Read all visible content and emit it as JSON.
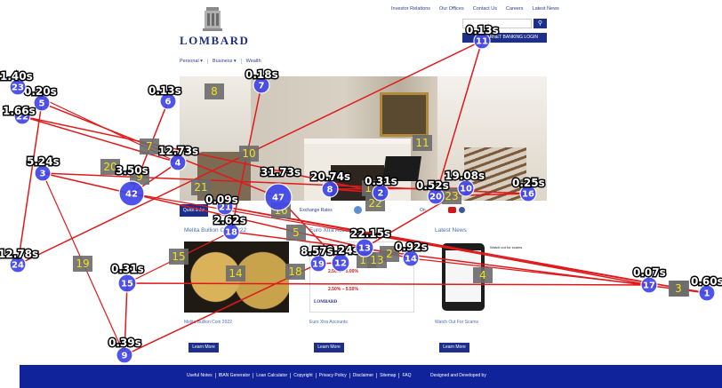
{
  "header": {
    "links": [
      "Investor Relations",
      "Our Offices",
      "Contact Us",
      "Careers",
      "Latest News"
    ],
    "brand": "LOMBARD",
    "search_icon": "search-icon",
    "internet_banking": "INTERNET BANKING LOGIN"
  },
  "nav": [
    "Personal ▾",
    "Business ▾",
    "Wealth"
  ],
  "subbar": {
    "quick_links": "Quick links",
    "exchange_rates": "Exchange Rates",
    "follow_us": "On"
  },
  "cards": [
    {
      "title": "Melita Bullion Coin 2022",
      "caption": "Melita Bullion Coin 2022",
      "button": "Learn More"
    },
    {
      "title": "Euro Xtra Accounts",
      "caption": "Euro Xtra Accounts",
      "button": "Learn More",
      "rates": [
        "2.50% – 5.00%",
        "2.50% – 5.50%"
      ]
    },
    {
      "title": "Latest News",
      "caption": "Watch Out For Scams",
      "button": "Learn More",
      "note": "Watch out for scams"
    }
  ],
  "footer": {
    "links": [
      "Useful Notes",
      "IBAN Generator",
      "Loan Calculator",
      "Copyright",
      "Privacy Policy",
      "Disclaimer",
      "Sitemap",
      "FAQ"
    ],
    "credit": "Designed and Developed by"
  },
  "overlay": {
    "path_color": "#e0191b",
    "fixation_fill": "#4046e8",
    "label_box_color": "#6b6b6b",
    "label_text_color": "#f3e21a",
    "fixations": [
      {
        "n": "1",
        "label": "0.60s"
      },
      {
        "n": "2",
        "label": "0.31s"
      },
      {
        "n": "3",
        "label": "5.24s"
      },
      {
        "n": "4",
        "label": "12.73s"
      },
      {
        "n": "5",
        "label": "0.20s"
      },
      {
        "n": "6",
        "label": "0.13s"
      },
      {
        "n": "7",
        "label": "0.18s"
      },
      {
        "n": "8",
        "label": "20.74s"
      },
      {
        "n": "9",
        "label": "0.39s"
      },
      {
        "n": "10",
        "label": "19.08s"
      },
      {
        "n": "11",
        "label": "0.13s"
      },
      {
        "n": "12",
        "label": "0.24s"
      },
      {
        "n": "13",
        "label": "22.15s"
      },
      {
        "n": "14",
        "label": "0.92s"
      },
      {
        "n": "15",
        "label": "0.31s"
      },
      {
        "n": "16",
        "label": "0.25s"
      },
      {
        "n": "17",
        "label": "0.07s"
      },
      {
        "n": "18",
        "label": "2.62s"
      },
      {
        "n": "19",
        "label": "8.57s"
      },
      {
        "n": "20",
        "label": "0.52s"
      },
      {
        "n": "21",
        "label": "0.09s"
      },
      {
        "n": "22",
        "label": "1.66s"
      },
      {
        "n": "23",
        "label": "1.40s"
      },
      {
        "n": "24",
        "label": "12.78s"
      },
      {
        "n": "42",
        "label": "3.50s"
      },
      {
        "n": "47",
        "label": "31.73s"
      }
    ],
    "seq_labels": [
      "1",
      "2",
      "3",
      "4",
      "5",
      "7",
      "8",
      "9",
      "10",
      "11",
      "12",
      "13",
      "14",
      "15",
      "16",
      "17",
      "18",
      "19",
      "20",
      "21",
      "22",
      "23"
    ]
  }
}
